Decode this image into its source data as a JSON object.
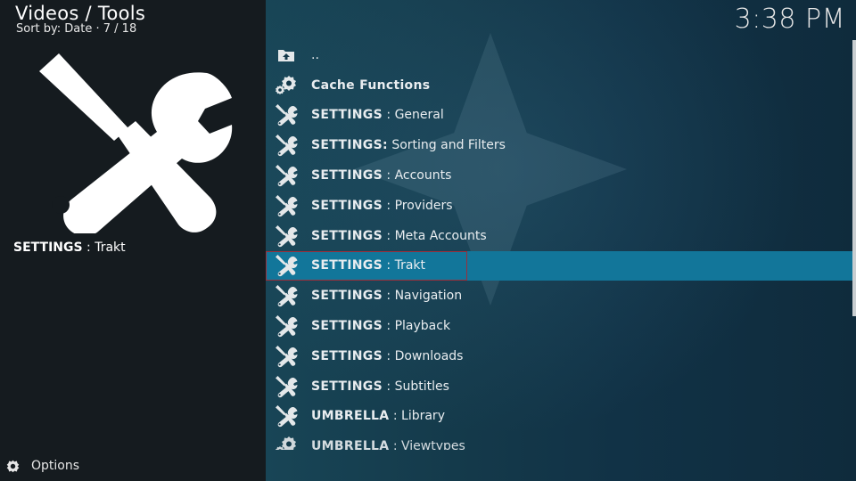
{
  "header": {
    "title": "Videos / Tools",
    "subtitle": "Sort by: Date  ·  7 / 18"
  },
  "clock": "3:38 PM",
  "preview": {
    "icon": "tools-icon",
    "label_bold": "SETTINGS",
    "label_rest": " : Trakt"
  },
  "footer": {
    "options_icon": "options-icon",
    "options_label": "Options"
  },
  "list": {
    "items": [
      {
        "icon": "folder-up-icon",
        "bold": "",
        "rest": ".."
      },
      {
        "icon": "gears-icon",
        "bold": "Cache Functions",
        "rest": ""
      },
      {
        "icon": "tools-icon",
        "bold": "SETTINGS",
        "rest": " : General"
      },
      {
        "icon": "tools-icon",
        "bold": "SETTINGS:",
        "rest": " Sorting and Filters"
      },
      {
        "icon": "tools-icon",
        "bold": "SETTINGS",
        "rest": " : Accounts"
      },
      {
        "icon": "tools-icon",
        "bold": "SETTINGS",
        "rest": " : Providers"
      },
      {
        "icon": "tools-icon",
        "bold": "SETTINGS",
        "rest": " : Meta Accounts"
      },
      {
        "icon": "tools-icon",
        "bold": "SETTINGS",
        "rest": " : Trakt",
        "selected": true
      },
      {
        "icon": "tools-icon",
        "bold": "SETTINGS",
        "rest": " : Navigation"
      },
      {
        "icon": "tools-icon",
        "bold": "SETTINGS",
        "rest": " : Playback"
      },
      {
        "icon": "tools-icon",
        "bold": "SETTINGS",
        "rest": " : Downloads"
      },
      {
        "icon": "tools-icon",
        "bold": "SETTINGS",
        "rest": " : Subtitles"
      },
      {
        "icon": "tools-icon",
        "bold": "UMBRELLA",
        "rest": " : Library"
      },
      {
        "icon": "gears-icon",
        "bold": "UMBRELLA",
        "rest": " : Viewtypes"
      }
    ]
  },
  "colors": {
    "selected_row": "#12769a",
    "focus_border": "#9a2f3c",
    "left_panel": "#151b1f"
  }
}
